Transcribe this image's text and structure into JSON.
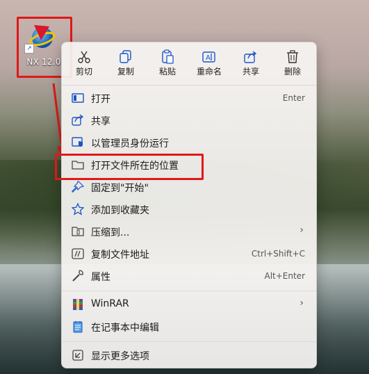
{
  "desktop": {
    "icon_label": "NX 12.0",
    "shortcut_glyph": "↗",
    "app_icon": "nx-logo-icon"
  },
  "context_menu": {
    "toolbar": [
      {
        "id": "cut",
        "label": "剪切",
        "icon": "scissors-icon"
      },
      {
        "id": "copy",
        "label": "复制",
        "icon": "copy-icon"
      },
      {
        "id": "paste",
        "label": "粘贴",
        "icon": "paste-icon"
      },
      {
        "id": "rename",
        "label": "重命名",
        "icon": "rename-icon"
      },
      {
        "id": "share",
        "label": "共享",
        "icon": "share-icon"
      },
      {
        "id": "delete",
        "label": "删除",
        "icon": "trash-icon"
      }
    ],
    "items": [
      {
        "label": "打开",
        "shortcut": "Enter",
        "icon": "open-app-icon"
      },
      {
        "label": "共享",
        "shortcut": "",
        "icon": "share-icon"
      },
      {
        "label": "以管理员身份运行",
        "shortcut": "",
        "icon": "shield-icon"
      },
      {
        "label": "打开文件所在的位置",
        "shortcut": "",
        "icon": "folder-icon"
      },
      {
        "label": "固定到\"开始\"",
        "shortcut": "",
        "icon": "pin-icon"
      },
      {
        "label": "添加到收藏夹",
        "shortcut": "",
        "icon": "star-icon"
      },
      {
        "label": "压缩到...",
        "shortcut": "",
        "icon": "zip-icon",
        "submenu": "›"
      },
      {
        "label": "复制文件地址",
        "shortcut": "Ctrl+Shift+C",
        "icon": "path-copy-icon"
      },
      {
        "label": "属性",
        "shortcut": "Alt+Enter",
        "icon": "wrench-icon"
      },
      {
        "label": "WinRAR",
        "shortcut": "",
        "icon": "winrar-icon",
        "submenu": "›"
      },
      {
        "label": "在记事本中编辑",
        "shortcut": "",
        "icon": "notepad-icon"
      },
      {
        "label": "显示更多选项",
        "shortcut": "",
        "icon": "more-options-icon"
      }
    ]
  },
  "annotation": {
    "highlight_color": "#e01818"
  }
}
